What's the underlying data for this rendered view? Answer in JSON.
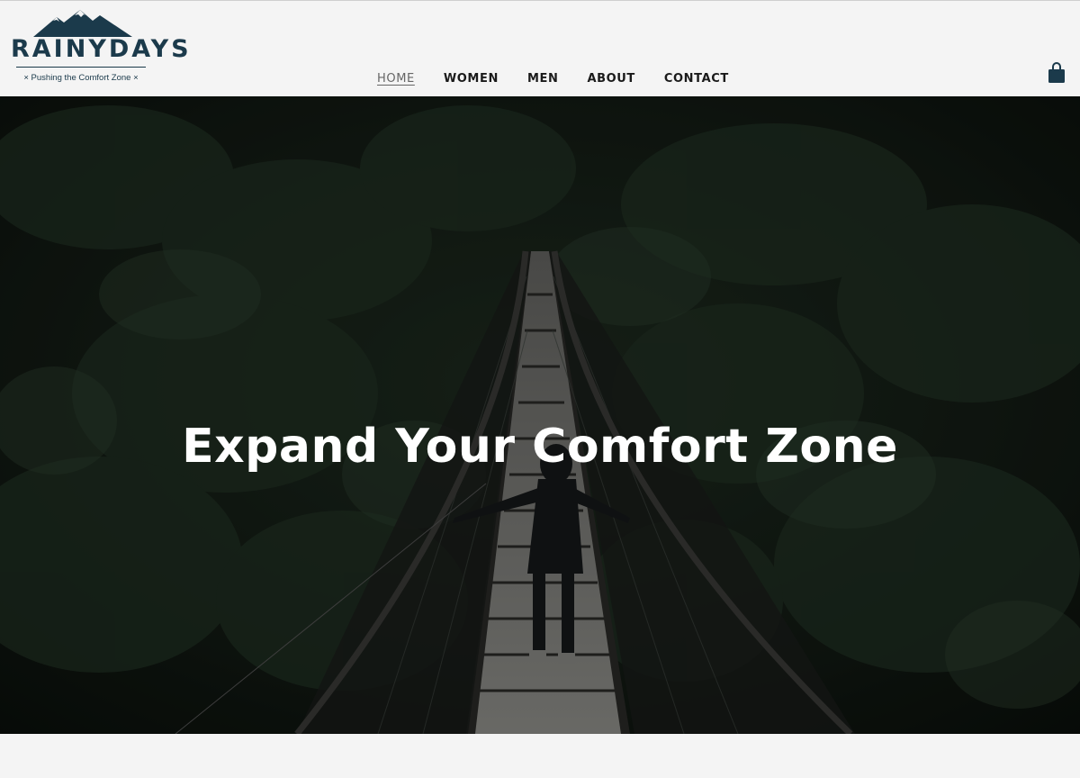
{
  "brand": {
    "name": "RAINYDAYS",
    "tagline": "× Pushing the Comfort Zone ×",
    "color": "#1b3a4b"
  },
  "nav": {
    "items": [
      {
        "label": "HOME",
        "active": true
      },
      {
        "label": "WOMEN",
        "active": false
      },
      {
        "label": "MEN",
        "active": false
      },
      {
        "label": "ABOUT",
        "active": false
      },
      {
        "label": "CONTACT",
        "active": false
      }
    ],
    "cart_icon": "shopping-bag-icon"
  },
  "hero": {
    "title": "Expand Your Comfort Zone",
    "scene": "forest-suspension-bridge",
    "colors": {
      "forest_dark": "#0e140f",
      "forest_mid": "#1c2a1e",
      "bridge_plank": "#8a8a86"
    }
  }
}
